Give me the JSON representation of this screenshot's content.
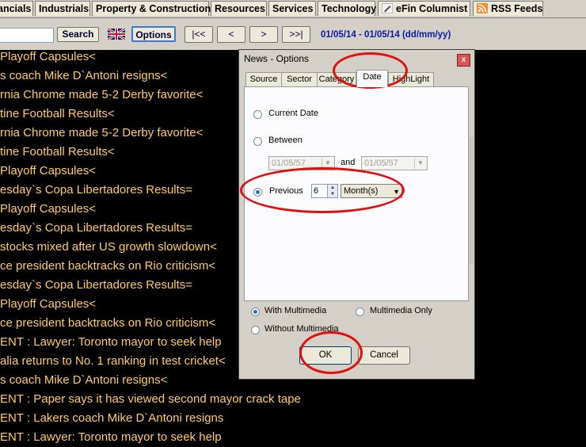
{
  "top_tabs": [
    "ancials",
    "Industrials",
    "Property & Construction",
    "Resources",
    "Services",
    "Technology",
    "eFin Columnist",
    "RSS Feeds"
  ],
  "toolbar": {
    "search_label": "Search",
    "options_label": "Options",
    "first_label": "|<<",
    "prev_label": "<",
    "next_label": ">",
    "last_label": ">>|",
    "date_range": "01/05/14 - 01/05/14 (dd/mm/yy)"
  },
  "news": [
    "Playoff Capsules<",
    "s coach Mike D`Antoni resigns<",
    "rnia Chrome made 5-2 Derby favorite<",
    "tine Football Results<",
    "rnia Chrome made 5-2 Derby favorite<",
    "tine Football Results<",
    "Playoff Capsules<",
    "esday`s Copa Libertadores Results=",
    "Playoff Capsules<",
    "esday`s Copa Libertadores Results=",
    " stocks mixed after US growth slowdown<",
    "ce president backtracks on Rio criticism<",
    "esday`s Copa Libertadores Results=",
    "Playoff Capsules<",
    "ce president backtracks on Rio criticism<",
    "ENT : Lawyer: Toronto mayor to seek help",
    "alia returns to No. 1 ranking in test cricket<",
    "s coach Mike D`Antoni resigns<",
    "ENT : Paper says it has viewed second mayor crack tape",
    "ENT : Lakers coach Mike D`Antoni resigns",
    "ENT : Lawyer: Toronto mayor to seek help"
  ],
  "dialog": {
    "title": "News - Options",
    "close": "x",
    "tabs": [
      "Source",
      "Sector",
      "Category",
      "Date",
      "HighLight"
    ],
    "current_date": "Current Date",
    "between": "Between",
    "from_date": "01/05/57",
    "and": "and",
    "to_date": "01/05/57",
    "previous": "Previous",
    "previous_value": "6",
    "unit": "Month(s)",
    "with_mm": "With Multimedia",
    "mm_only": "Multimedia Only",
    "without_mm": "Without Multimedia",
    "ok": "OK",
    "cancel": "Cancel"
  },
  "colors": {
    "news_text": "#ffcc66",
    "date_range": "#0a1aa8",
    "annotation": "#e01010"
  },
  "icons": {
    "efin": "pen-icon",
    "rss": "rss-icon",
    "flag": "uk-flag-icon"
  }
}
